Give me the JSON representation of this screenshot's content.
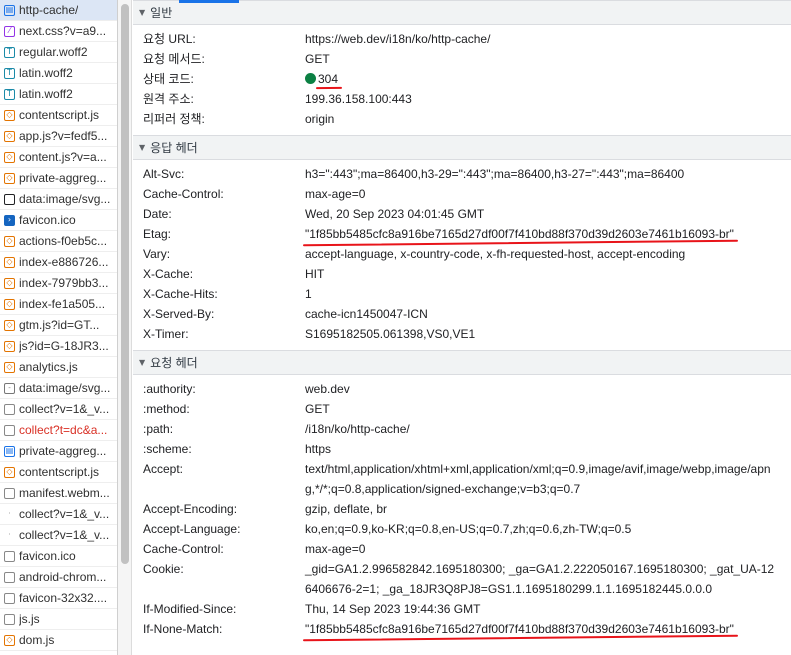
{
  "requests": [
    {
      "name": "http-cache/",
      "icon": "document-icon",
      "glyph": "▤",
      "cls": "ic-doc",
      "selected": true
    },
    {
      "name": "next.css?v=a9...",
      "icon": "stylesheet-icon",
      "glyph": "⁄",
      "cls": "ic-css"
    },
    {
      "name": "regular.woff2",
      "icon": "font-icon",
      "glyph": "T",
      "cls": "ic-font"
    },
    {
      "name": "latin.woff2",
      "icon": "font-icon",
      "glyph": "T",
      "cls": "ic-font"
    },
    {
      "name": "latin.woff2",
      "icon": "font-icon",
      "glyph": "T",
      "cls": "ic-font"
    },
    {
      "name": "contentscript.js",
      "icon": "script-icon",
      "glyph": "◇",
      "cls": "ic-js"
    },
    {
      "name": "app.js?v=fedf5...",
      "icon": "script-icon",
      "glyph": "◇",
      "cls": "ic-js"
    },
    {
      "name": "content.js?v=a...",
      "icon": "script-icon",
      "glyph": "◇",
      "cls": "ic-js"
    },
    {
      "name": "private-aggreg...",
      "icon": "script-icon",
      "glyph": "◇",
      "cls": "ic-js"
    },
    {
      "name": "data:image/svg...",
      "icon": "image-icon",
      "glyph": "",
      "cls": "ic-img"
    },
    {
      "name": "favicon.ico",
      "icon": "powershell-icon",
      "glyph": "›",
      "cls": "ic-ps"
    },
    {
      "name": "actions-f0eb5c...",
      "icon": "script-icon",
      "glyph": "◇",
      "cls": "ic-js"
    },
    {
      "name": "index-e886726...",
      "icon": "script-icon",
      "glyph": "◇",
      "cls": "ic-js"
    },
    {
      "name": "index-7979bb3...",
      "icon": "script-icon",
      "glyph": "◇",
      "cls": "ic-js"
    },
    {
      "name": "index-fe1a505...",
      "icon": "script-icon",
      "glyph": "◇",
      "cls": "ic-js"
    },
    {
      "name": "gtm.js?id=GT...",
      "icon": "script-icon",
      "glyph": "◇",
      "cls": "ic-js"
    },
    {
      "name": "js?id=G-18JR3...",
      "icon": "script-icon",
      "glyph": "◇",
      "cls": "ic-js"
    },
    {
      "name": "analytics.js",
      "icon": "script-icon",
      "glyph": "◇",
      "cls": "ic-js"
    },
    {
      "name": "data:image/svg...",
      "icon": "image-icon",
      "glyph": "-",
      "cls": "ic-img2"
    },
    {
      "name": "collect?v=1&_v...",
      "icon": "generic-request-icon",
      "glyph": "",
      "cls": "ic-gen"
    },
    {
      "name": "collect?t=dc&a...",
      "icon": "generic-request-icon",
      "glyph": "",
      "cls": "ic-gen",
      "error": true
    },
    {
      "name": "private-aggreg...",
      "icon": "document-icon",
      "glyph": "▤",
      "cls": "ic-doc"
    },
    {
      "name": "contentscript.js",
      "icon": "script-icon",
      "glyph": "◇",
      "cls": "ic-js"
    },
    {
      "name": "manifest.webm...",
      "icon": "generic-request-icon",
      "glyph": "",
      "cls": "ic-gen"
    },
    {
      "name": "collect?v=1&_v...",
      "icon": "dot-icon",
      "glyph": "·",
      "cls": "ic-dot"
    },
    {
      "name": "collect?v=1&_v...",
      "icon": "dot-icon",
      "glyph": "·",
      "cls": "ic-dot"
    },
    {
      "name": "favicon.ico",
      "icon": "generic-request-icon",
      "glyph": "",
      "cls": "ic-gen"
    },
    {
      "name": "android-chrom...",
      "icon": "generic-request-icon",
      "glyph": "",
      "cls": "ic-gen"
    },
    {
      "name": "favicon-32x32....",
      "icon": "generic-request-icon",
      "glyph": "",
      "cls": "ic-gen"
    },
    {
      "name": "js.js",
      "icon": "generic-request-icon",
      "glyph": "",
      "cls": "ic-gen"
    },
    {
      "name": "dom.js",
      "icon": "script-icon",
      "glyph": "◇",
      "cls": "ic-js"
    }
  ],
  "sections": [
    {
      "title": "일반",
      "rows": [
        {
          "key": "요청 URL:",
          "value": "https://web.dev/i18n/ko/http-cache/"
        },
        {
          "key": "요청 메서드:",
          "value": "GET"
        },
        {
          "key": "상태 코드:",
          "value": "304",
          "status_dot": true,
          "marked": true
        },
        {
          "key": "원격 주소:",
          "value": "199.36.158.100:443"
        },
        {
          "key": "리퍼러 정책:",
          "value": "origin"
        }
      ]
    },
    {
      "title": "응답 헤더",
      "rows": [
        {
          "key": "Alt-Svc:",
          "value": "h3=\":443\";ma=86400,h3-29=\":443\";ma=86400,h3-27=\":443\";ma=86400"
        },
        {
          "key": "Cache-Control:",
          "value": "max-age=0"
        },
        {
          "key": "Date:",
          "value": "Wed, 20 Sep 2023 04:01:45 GMT"
        },
        {
          "key": "Etag:",
          "value": "\"1f85bb5485cfc8a916be7165d27df00f7f410bd88f370d39d2603e7461b16093-br\"",
          "marked": true
        },
        {
          "key": "Vary:",
          "value": "accept-language, x-country-code, x-fh-requested-host, accept-encoding"
        },
        {
          "key": "X-Cache:",
          "value": "HIT"
        },
        {
          "key": "X-Cache-Hits:",
          "value": "1"
        },
        {
          "key": "X-Served-By:",
          "value": "cache-icn1450047-ICN"
        },
        {
          "key": "X-Timer:",
          "value": "S1695182505.061398,VS0,VE1"
        }
      ]
    },
    {
      "title": "요청 헤더",
      "rows": [
        {
          "key": ":authority:",
          "value": "web.dev"
        },
        {
          "key": ":method:",
          "value": "GET"
        },
        {
          "key": ":path:",
          "value": "/i18n/ko/http-cache/"
        },
        {
          "key": ":scheme:",
          "value": "https"
        },
        {
          "key": "Accept:",
          "value": "text/html,application/xhtml+xml,application/xml;q=0.9,image/avif,image/webp,image/apng,*/*;q=0.8,application/signed-exchange;v=b3;q=0.7"
        },
        {
          "key": "Accept-Encoding:",
          "value": "gzip, deflate, br"
        },
        {
          "key": "Accept-Language:",
          "value": "ko,en;q=0.9,ko-KR;q=0.8,en-US;q=0.7,zh;q=0.6,zh-TW;q=0.5"
        },
        {
          "key": "Cache-Control:",
          "value": "max-age=0"
        },
        {
          "key": "Cookie:",
          "value": "_gid=GA1.2.996582842.1695180300; _ga=GA1.2.222050167.1695180300; _gat_UA-126406676-2=1; _ga_18JR3Q8PJ8=GS1.1.1695180299.1.1.1695182445.0.0.0"
        },
        {
          "key": "If-Modified-Since:",
          "value": "Thu, 14 Sep 2023 19:44:36 GMT"
        },
        {
          "key": "If-None-Match:",
          "value": "\"1f85bb5485cfc8a916be7165d27df00f7f410bd88f370d39d2603e7461b16093-br\"",
          "marked": true
        }
      ]
    }
  ],
  "colors": {
    "accent": "#1a73e8",
    "status_ok": "#0b8043",
    "annotation": "#e8141a",
    "error_text": "#d93025"
  }
}
